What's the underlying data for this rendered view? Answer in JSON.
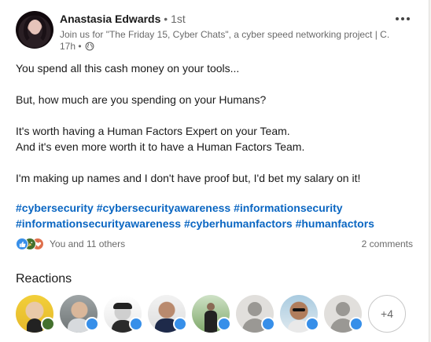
{
  "post": {
    "author": {
      "name": "Anastasia Edwards",
      "degree": "• 1st"
    },
    "headline": "Join us for \"The Friday 15, Cyber Chats\", a cyber speed networking project | C...",
    "time": "17h •",
    "visibility_icon": "globe-icon",
    "more_icon": "more-options-icon",
    "body": [
      "You spend all this cash money on your tools...",
      "But, how much are you spending on your Humans?",
      "It's worth having a Human Factors Expert on your Team.",
      "And it's even more worth it to have a Human Factors Team.",
      "I'm making up names and I don't have proof but, I'd bet my salary on it!"
    ],
    "hashtags": [
      "#cybersecurity",
      "#cybersecurityawareness",
      "#informationsecurity",
      "#informationsecurityawareness",
      "#cyberhumanfactors",
      "#humanfactors"
    ]
  },
  "social": {
    "reactions_text": "You and 11 others",
    "comments_text": "2 comments",
    "reaction_types": [
      "like",
      "celebrate",
      "love"
    ]
  },
  "reactions_section": {
    "title": "Reactions",
    "more_count": "+4"
  },
  "colors": {
    "link": "#0a66c2",
    "like": "#378fe9",
    "celebrate": "#44712e",
    "love": "#df704d"
  }
}
